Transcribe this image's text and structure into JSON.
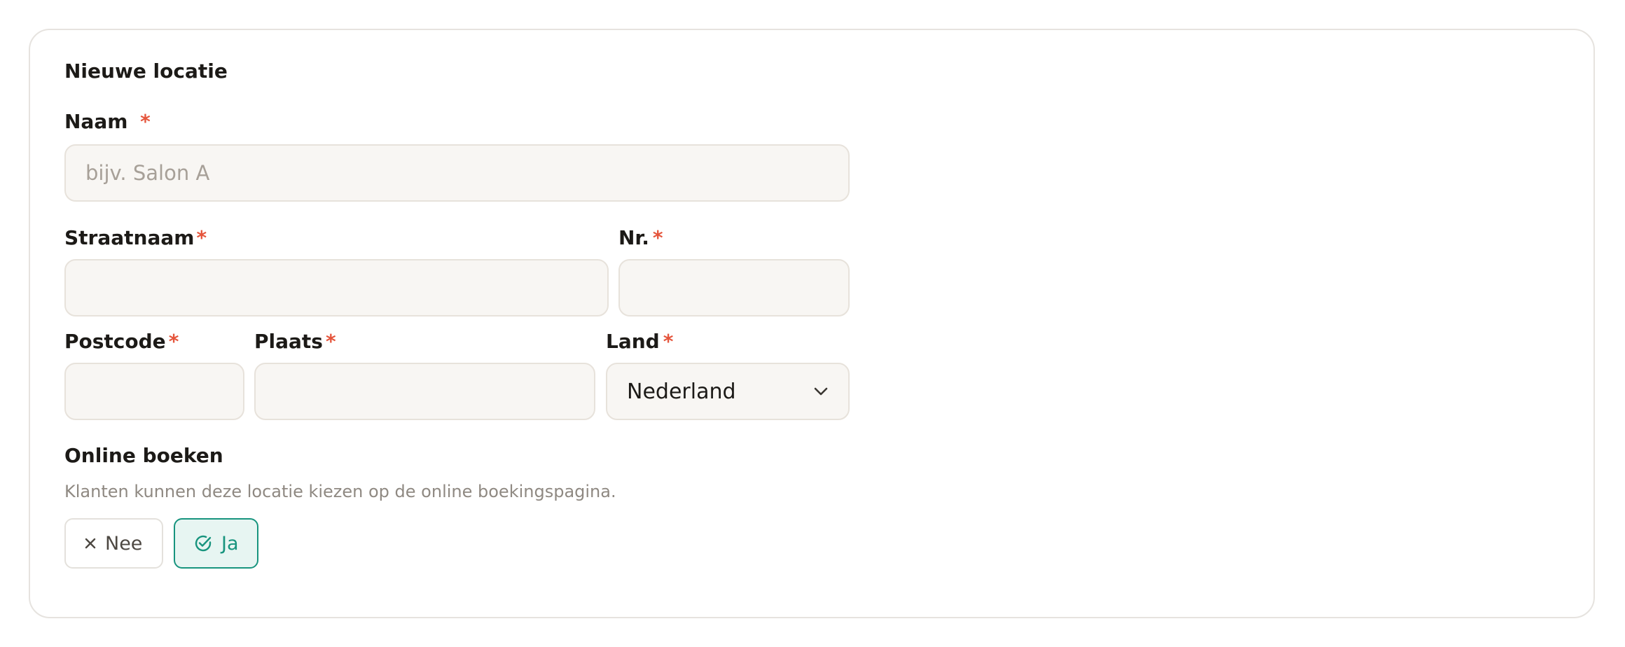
{
  "form": {
    "title": "Nieuwe locatie",
    "required_marker": "*",
    "name": {
      "label": "Naam",
      "placeholder": "bijv. Salon A",
      "value": ""
    },
    "street": {
      "label": "Straatnaam",
      "value": ""
    },
    "number": {
      "label": "Nr.",
      "value": ""
    },
    "postcode": {
      "label": "Postcode",
      "value": ""
    },
    "city": {
      "label": "Plaats",
      "value": ""
    },
    "country": {
      "label": "Land",
      "selected": "Nederland"
    },
    "online_booking": {
      "title": "Online boeken",
      "description": "Klanten kunnen deze locatie kiezen op de online boekingspagina.",
      "option_no": "Nee",
      "option_yes": "Ja",
      "selected": "Ja"
    }
  },
  "icons": {
    "no": "close-icon",
    "yes": "check-circle-icon",
    "select": "chevron-down-icon"
  },
  "colors": {
    "required": "#e5553c",
    "accent": "#17947e",
    "accent_bg": "#e7f5f2",
    "input_bg": "#f8f6f3",
    "muted_text": "#8f8982"
  }
}
